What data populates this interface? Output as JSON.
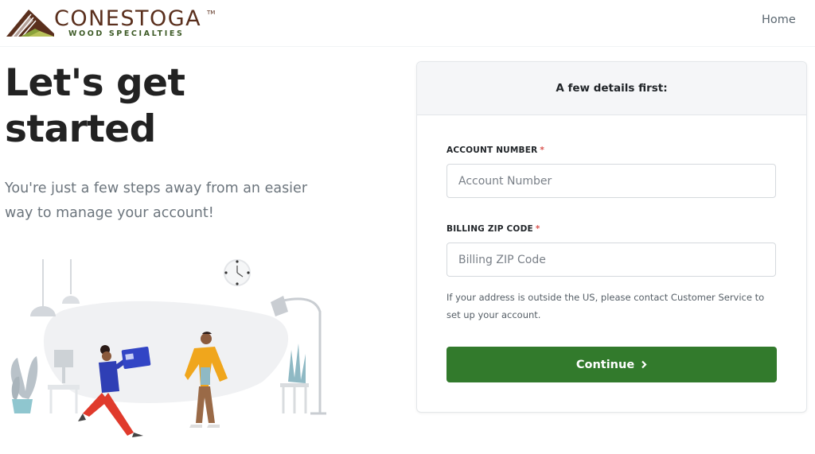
{
  "brand": {
    "name": "CONESTOGA",
    "trademark": "TM",
    "tagline": "WOOD SPECIALTIES"
  },
  "nav": {
    "home_label": "Home"
  },
  "hero": {
    "title_line1": "Let's get",
    "title_line2": "started",
    "subtitle": "You're just a few steps away from an easier way to manage your account!"
  },
  "form": {
    "header": "A few details first:",
    "account_label": "ACCOUNT NUMBER",
    "account_placeholder": "Account Number",
    "account_value": "",
    "zip_label": "BILLING ZIP CODE",
    "zip_placeholder": "Billing ZIP Code",
    "zip_value": "",
    "required_mark": "*",
    "help_text": "If your address is outside the US, please contact Customer Service to set up your account.",
    "continue_label": "Continue"
  },
  "colors": {
    "brand_brown": "#5a2f1d",
    "brand_green": "#3d5a26",
    "button_green": "#327a2c",
    "required_red": "#d9534f"
  },
  "icons": [
    "conestoga-logo-icon",
    "chevron-right-icon",
    "clock-icon",
    "lamp-icon",
    "plant-icon"
  ]
}
